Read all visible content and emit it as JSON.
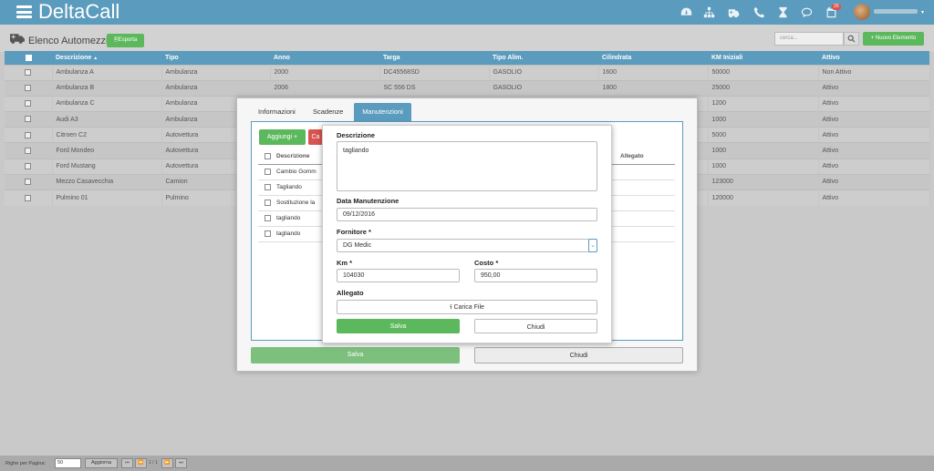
{
  "app": {
    "brand": "DeltaCall",
    "notification_count": "20"
  },
  "page": {
    "title": "Elenco Automezzi",
    "export_label": "Esporta",
    "search_placeholder": "cerca...",
    "new_label": "Nuovo Elemento"
  },
  "table": {
    "headers": [
      "Descrizione",
      "Tipo",
      "Anno",
      "Targa",
      "Tipo Alim.",
      "Cilindrata",
      "KM Iniziali",
      "Attivo"
    ],
    "sort_indicator": "▲",
    "rows": [
      [
        "Ambulanza A",
        "Ambulanza",
        "2000",
        "DC45568SD",
        "GASOLIO",
        "1600",
        "50000",
        "Non Attivo"
      ],
      [
        "Ambulanza B",
        "Ambulanza",
        "2006",
        "SC 556 DS",
        "GASOLIO",
        "1800",
        "25000",
        "Attivo"
      ],
      [
        "Ambulanza C",
        "Ambulanza",
        "",
        "",
        "",
        "",
        "1200",
        "Attivo"
      ],
      [
        "Audi A3",
        "Ambulanza",
        "",
        "",
        "",
        "",
        "1000",
        "Attivo"
      ],
      [
        "Citroen C2",
        "Autovettura",
        "",
        "",
        "",
        "",
        "5000",
        "Attivo"
      ],
      [
        "Ford Mondeo",
        "Autovettura",
        "",
        "",
        "",
        "",
        "1000",
        "Attivo"
      ],
      [
        "Ford Mustang",
        "Autovettura",
        "",
        "",
        "",
        "",
        "1000",
        "Attivo"
      ],
      [
        "Mezzo Casavecchia",
        "Camion",
        "",
        "",
        "",
        "",
        "123000",
        "Attivo"
      ],
      [
        "Pulmino 01",
        "Pulmino",
        "",
        "",
        "",
        "",
        "120000",
        "Attivo"
      ]
    ]
  },
  "edit_dialog": {
    "tabs": [
      "Informazioni",
      "Scadenze",
      "Manutenzioni"
    ],
    "active_tab": "Manutenzioni",
    "add_label": "Aggiungi",
    "cancel_label_partial": "Ca",
    "list_headers": [
      "Descrizione",
      "Allegato"
    ],
    "list_items": [
      "Cambio Gomm",
      "Tagliando",
      "Sostituzione la",
      "tagliando",
      "tagliando"
    ],
    "save_label": "Salva",
    "close_label": "Chiudi"
  },
  "maintenance_form": {
    "descrizione_label": "Descrizione",
    "descrizione_value": "tagliando",
    "data_label": "Data Manutenzione",
    "data_value": "09/12/2016",
    "fornitore_label": "Fornitore *",
    "fornitore_value": "DG Medic",
    "km_label": "Km *",
    "km_value": "104030",
    "costo_label": "Costo *",
    "costo_value": "950,00",
    "allegato_label": "Allegato",
    "upload_label": "Carica File",
    "save_label": "Salva",
    "close_label": "Chiudi"
  },
  "footer": {
    "rows_label": "Righe per Pagina:",
    "rows_value": "50",
    "refresh_label": "Aggiorna",
    "page_info": "1 / 1"
  },
  "colors": {
    "primary": "#5b9bbd",
    "success": "#5cb85c",
    "danger": "#d9534f"
  }
}
